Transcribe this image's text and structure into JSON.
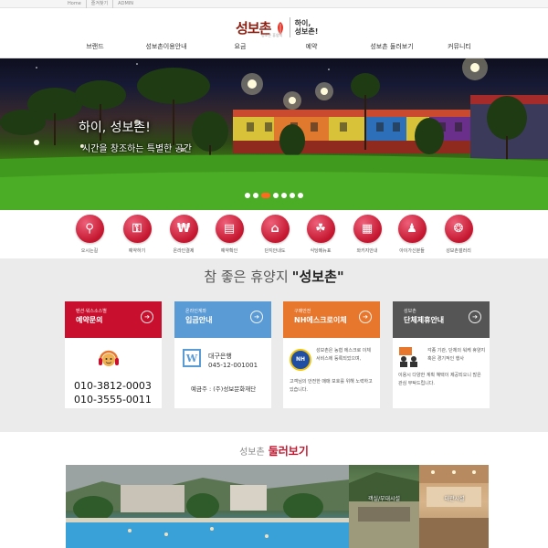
{
  "utility": {
    "links": [
      "Home",
      "즐겨찾기",
      "ADMIN"
    ]
  },
  "logo": {
    "mark": "성보촌",
    "sub": "성보촌 휴양지",
    "tagline_line1": "하이,",
    "tagline_line2": "성보촌!"
  },
  "nav": {
    "items": [
      "브랜드",
      "성보촌이용안내",
      "요금",
      "예약",
      "성보촌 둘러보기",
      "커뮤니티"
    ]
  },
  "hero": {
    "caption_line1": "하이, 성보촌!",
    "caption_line2": "시간을 창조하는 특별한 공간",
    "slides_total": 7,
    "active_slide": 3
  },
  "quick_menu": {
    "items": [
      {
        "label": "오시는길",
        "icon": "search-icon"
      },
      {
        "label": "예약하기",
        "icon": "lock-icon"
      },
      {
        "label": "온라인결제",
        "icon": "won-icon"
      },
      {
        "label": "예약확인",
        "icon": "document-icon"
      },
      {
        "label": "단지안내도",
        "icon": "map-icon"
      },
      {
        "label": "식당메뉴표",
        "icon": "plant-icon"
      },
      {
        "label": "와키지안내",
        "icon": "grid-icon"
      },
      {
        "label": "아이가신분들",
        "icon": "people-icon"
      },
      {
        "label": "성보촌갤러리",
        "icon": "film-icon"
      }
    ]
  },
  "section": {
    "title_prefix": "참 좋은 휴양지",
    "title_main": "\"성보촌\""
  },
  "cards": {
    "reservation": {
      "small": "펜션·워스소스별",
      "big": "예약문의",
      "color": "#c8102e",
      "phone1": "010-3812-0003",
      "phone2": "010-3555-0011"
    },
    "account": {
      "small": "온라인계좌",
      "big": "입금안내",
      "color": "#5b9bd5",
      "bank": "대구은행",
      "number": "045-12-001001",
      "holder": "예금주 : (주)성보문화재단"
    },
    "escrow": {
      "small": "구매안전",
      "big": "NH에스크로이체",
      "color": "#e8772e",
      "logo": "NH",
      "text1": "성보촌은 농협 에스크로 이체 서비스에 등록되었으며,",
      "text2": "고객님의 안전한 매매 보호를 위해 노력하고 있습니다."
    },
    "group": {
      "small": "성보촌",
      "big": "단체제휴안내",
      "color": "#555555",
      "text1": "각종 기관, 단체의 워케 휴양지 혹은 경기적인 행사",
      "text2": "이용시 다양한 계획 혜택이 제공되오니 많은 관심 부탁드립니다."
    }
  },
  "tour": {
    "title_prefix": "성보촌",
    "title_main": "둘러보기",
    "labels": [
      "객실/부대시설",
      "대관시설"
    ]
  }
}
